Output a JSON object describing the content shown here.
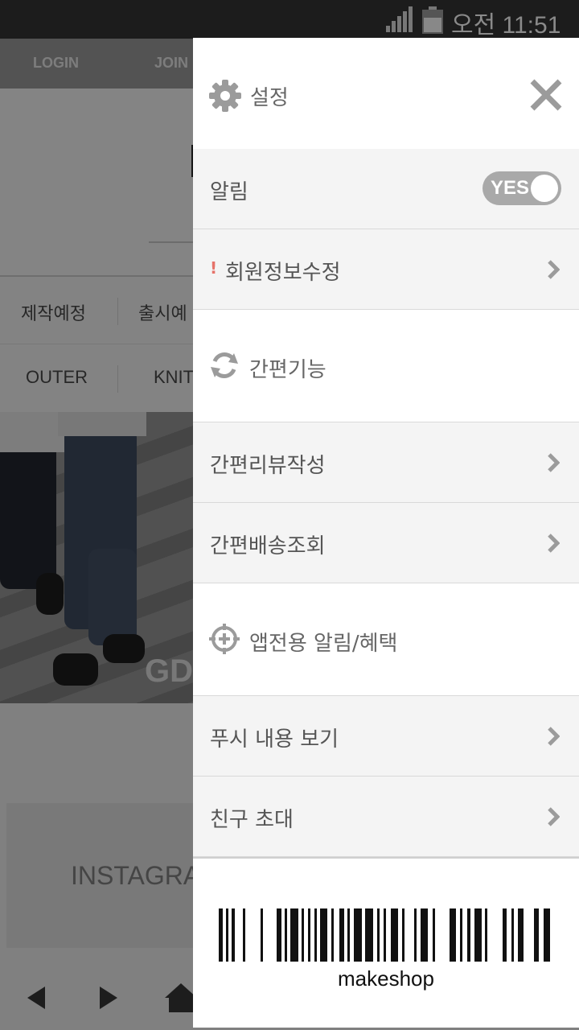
{
  "status_bar": {
    "time": "오전 11:51",
    "signal_icon": "signal-icon",
    "battery_icon": "battery-icon"
  },
  "background_app": {
    "top_nav": [
      "LOGIN",
      "JOIN"
    ],
    "categories_row1": [
      "제작예정",
      "출시예"
    ],
    "categories_row2": [
      "OUTER",
      "KNIT"
    ],
    "banner_text": "GD",
    "instagram_label": "INSTAGRA"
  },
  "drawer": {
    "title": "설정",
    "notification": {
      "label": "알림",
      "toggle_text": "YES",
      "enabled": true
    },
    "member_info": {
      "alert_mark": "!",
      "label": "회원정보수정"
    },
    "section_quick": {
      "label": "간편기능"
    },
    "quick_items": [
      {
        "label": "간편리뷰작성"
      },
      {
        "label": "간편배송조회"
      }
    ],
    "section_app": {
      "label": "앱전용 알림/혜택"
    },
    "app_items": [
      {
        "label": "푸시 내용 보기"
      },
      {
        "label": "친구 초대"
      }
    ],
    "footer": {
      "barcode_label": "makeshop"
    }
  },
  "colors": {
    "toggle_on": "#a9a9a9",
    "icon_gray": "#9b9b9b",
    "alert_red": "#e6736a"
  }
}
